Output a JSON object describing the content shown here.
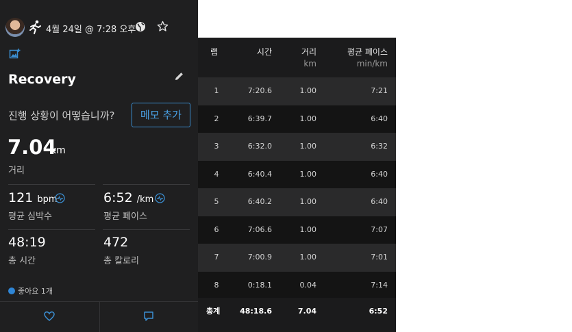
{
  "activity": {
    "date": "4월 24일 @ 7:28 오후",
    "title": "Recovery",
    "progress_question": "진행 상황이 어떻습니까?",
    "memo_button": "메모 추가",
    "distance": {
      "value": "7.04",
      "unit": "km",
      "label": "거리"
    },
    "avg_hr": {
      "value": "121",
      "unit": "bpm",
      "label": "평균 심박수"
    },
    "avg_pace": {
      "value": "6:52",
      "unit": "/km",
      "label": "평균 페이스"
    },
    "total_time": {
      "value": "48:19",
      "label": "총 시간"
    },
    "calories": {
      "value": "472",
      "label": "총 칼로리"
    },
    "likes": "좋아요 1개"
  },
  "colors": {
    "accent": "#3b8fd3",
    "card_bg": "#1f1f20",
    "table_bg": "#1b1b1c"
  },
  "icons": [
    "running-icon",
    "globe-icon",
    "star-icon",
    "add-photo-icon",
    "pencil-icon",
    "heart-rate-icon",
    "heart-icon",
    "comment-icon"
  ],
  "laps": {
    "headers": {
      "lap": "랩",
      "time": "시간",
      "distance": "거리",
      "distance_unit": "km",
      "pace": "평균 페이스",
      "pace_unit": "min/km"
    },
    "rows": [
      {
        "lap": "1",
        "time": "7:20.6",
        "distance": "1.00",
        "pace": "7:21"
      },
      {
        "lap": "2",
        "time": "6:39.7",
        "distance": "1.00",
        "pace": "6:40"
      },
      {
        "lap": "3",
        "time": "6:32.0",
        "distance": "1.00",
        "pace": "6:32"
      },
      {
        "lap": "4",
        "time": "6:40.4",
        "distance": "1.00",
        "pace": "6:40"
      },
      {
        "lap": "5",
        "time": "6:40.2",
        "distance": "1.00",
        "pace": "6:40"
      },
      {
        "lap": "6",
        "time": "7:06.6",
        "distance": "1.00",
        "pace": "7:07"
      },
      {
        "lap": "7",
        "time": "7:00.9",
        "distance": "1.00",
        "pace": "7:01"
      },
      {
        "lap": "8",
        "time": "0:18.1",
        "distance": "0.04",
        "pace": "7:14"
      }
    ],
    "total": {
      "label": "총계",
      "time": "48:18.6",
      "distance": "7.04",
      "pace": "6:52"
    }
  }
}
